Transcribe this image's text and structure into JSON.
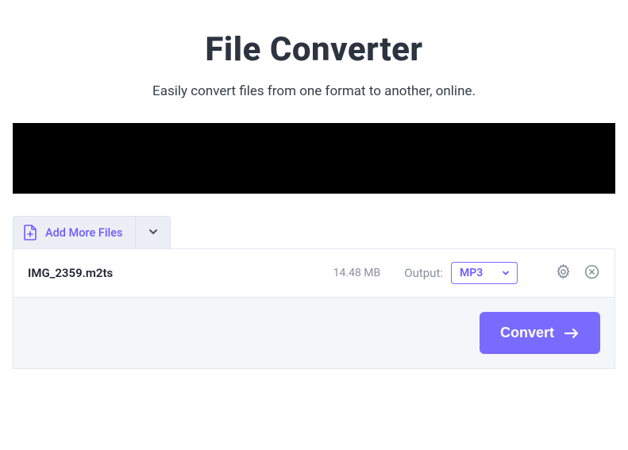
{
  "header": {
    "title": "File Converter",
    "subtitle": "Easily convert files from one format to another, online."
  },
  "toolbar": {
    "add_more_label": "Add More Files"
  },
  "file": {
    "name": "IMG_2359.m2ts",
    "size": "14.48 MB",
    "output_label": "Output:",
    "format": "MP3"
  },
  "actions": {
    "convert_label": "Convert"
  },
  "colors": {
    "accent": "#7a6bff"
  }
}
